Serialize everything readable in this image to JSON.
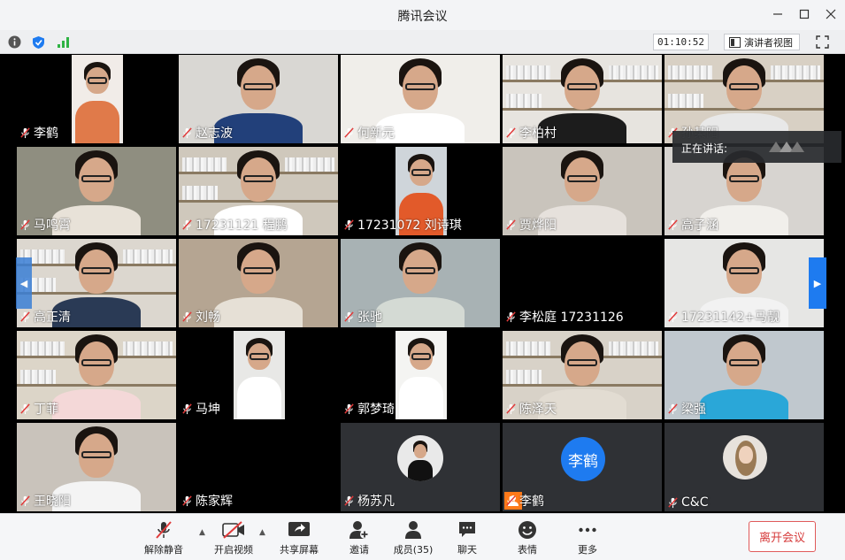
{
  "window": {
    "title": "腾讯会议"
  },
  "infobar": {
    "timer": "01:10:52",
    "presenter_view_label": "演讲者视图"
  },
  "speaking": {
    "label": "正在讲话:"
  },
  "participants": [
    {
      "name": "李鹤"
    },
    {
      "name": "赵志波"
    },
    {
      "name": "何新元"
    },
    {
      "name": "李柏村"
    },
    {
      "name": "孙某阳"
    },
    {
      "name": "马鸣霄"
    },
    {
      "name": "17231121 程鹏"
    },
    {
      "name": "17231072 刘诗琪"
    },
    {
      "name": "贾烨阳"
    },
    {
      "name": "高子涵"
    },
    {
      "name": "高正清"
    },
    {
      "name": "刘畅"
    },
    {
      "name": "张驰"
    },
    {
      "name": "李松庭 17231126"
    },
    {
      "name": "17231142+马靓"
    },
    {
      "name": "丁菲"
    },
    {
      "name": "马坤"
    },
    {
      "name": "郭梦琦"
    },
    {
      "name": "陈泽天"
    },
    {
      "name": "梁强"
    },
    {
      "name": "王晓阳"
    },
    {
      "name": "陈家辉"
    },
    {
      "name": "杨苏凡"
    },
    {
      "name": "李鹤"
    },
    {
      "name": "C&C"
    }
  ],
  "avatar_initials": "李鹤",
  "toolbar": {
    "unmute": "解除静音",
    "start_video": "开启视频",
    "share_screen": "共享屏幕",
    "invite": "邀请",
    "members": "成员(35)",
    "chat": "聊天",
    "reactions": "表情",
    "more": "更多",
    "leave": "离开会议"
  },
  "colors": {
    "accent": "#1e7bf0",
    "leave": "#d63b3b",
    "muted_mic": "#e03a3a"
  }
}
